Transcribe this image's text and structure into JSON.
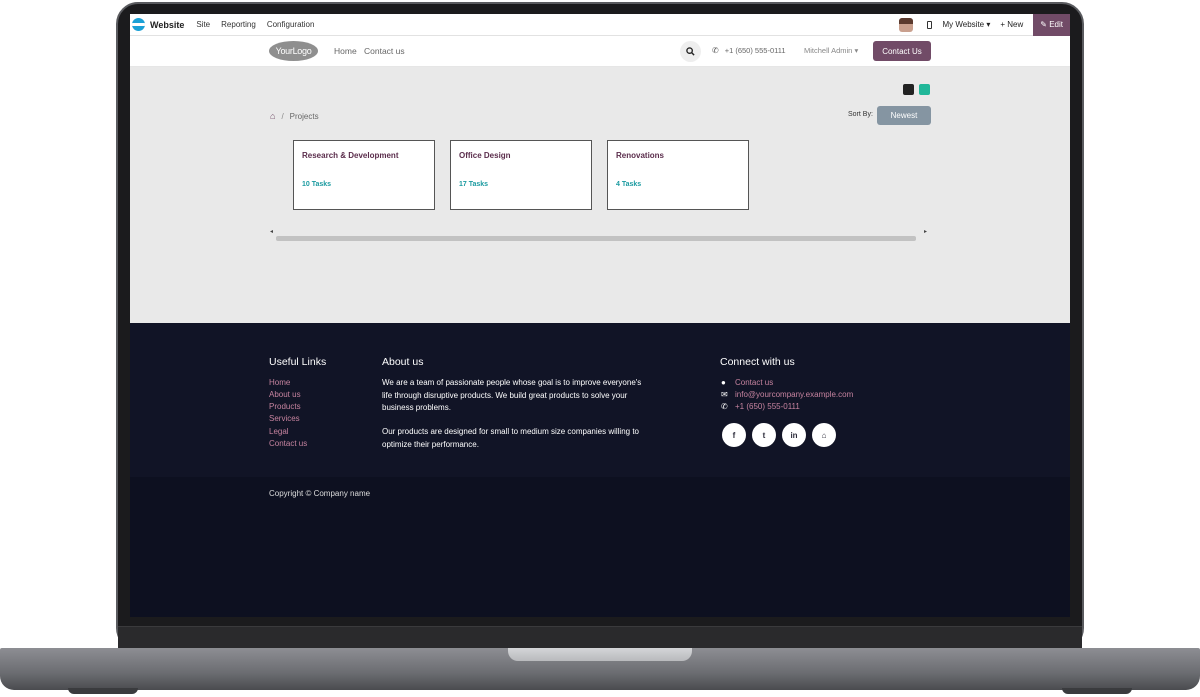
{
  "adminbar": {
    "app_name": "Website",
    "menus": [
      "Site",
      "Reporting",
      "Configuration"
    ],
    "my_website": "My Website ▾",
    "new": "+ New",
    "edit": "✎ Edit"
  },
  "header": {
    "logo": "YourLogo",
    "nav": [
      "Home",
      "Contact us"
    ],
    "phone": "+1 (650) 555-0111",
    "user": "Mitchell Admin",
    "contact_button": "Contact Us"
  },
  "main": {
    "breadcrumb": "Projects",
    "sort_label": "Sort By:",
    "sort_value": "Newest",
    "projects": [
      {
        "name": "Research & Development",
        "tasks": "10 Tasks"
      },
      {
        "name": "Office Design",
        "tasks": "17 Tasks"
      },
      {
        "name": "Renovations",
        "tasks": "4 Tasks"
      }
    ]
  },
  "footer": {
    "useful_links_title": "Useful Links",
    "useful_links": [
      "Home",
      "About us",
      "Products",
      "Services",
      "Legal",
      "Contact us"
    ],
    "about_title": "About us",
    "about_p1_l1": "We are a team of passionate people whose goal is to improve everyone's",
    "about_p1_l2": "life through disruptive products. We build great products to solve your",
    "about_p1_l3": "business problems.",
    "about_p2_l1": "Our products are designed for small to medium size companies willing to",
    "about_p2_l2": "optimize their performance.",
    "connect_title": "Connect with us",
    "contact_link": "Contact us",
    "email": "info@yourcompany.example.com",
    "phone": "+1 (650) 555-0111",
    "social": [
      "f",
      "t",
      "in",
      "⌂"
    ],
    "copyright": "Copyright © Company name"
  },
  "colors": {
    "brand": "#714b67",
    "footer_bg": "#111426",
    "accent_teal": "#21b799"
  }
}
